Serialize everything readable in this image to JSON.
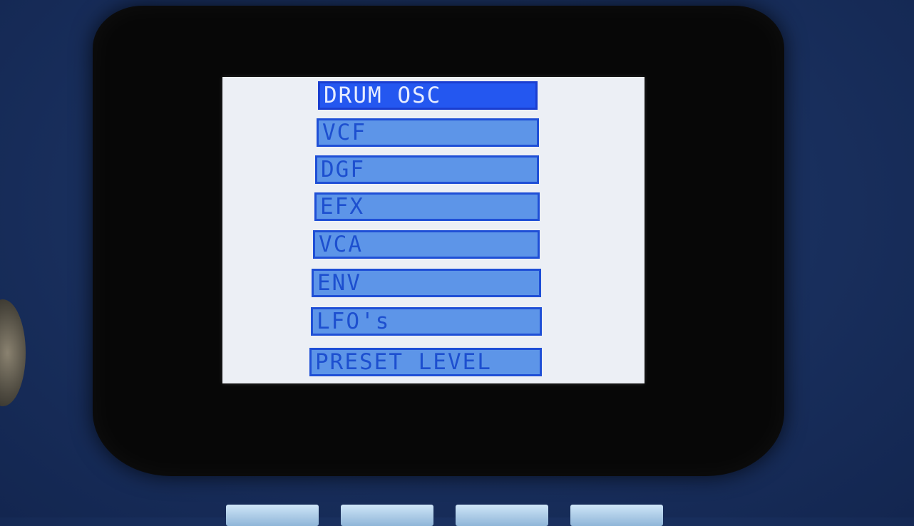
{
  "menu": {
    "items": [
      {
        "label": "DRUM OSC",
        "selected": true
      },
      {
        "label": "VCF",
        "selected": false
      },
      {
        "label": "DGF",
        "selected": false
      },
      {
        "label": "EFX",
        "selected": false
      },
      {
        "label": "VCA",
        "selected": false
      },
      {
        "label": "ENV",
        "selected": false
      },
      {
        "label": "LFO's",
        "selected": false
      },
      {
        "label": "PRESET LEVEL",
        "selected": false
      }
    ]
  },
  "colors": {
    "selected_bg": "#2457f0",
    "item_bg": "#5d95e8",
    "item_border": "#1f4fd6",
    "screen_bg": "#eceff5",
    "chassis": "#1a3160"
  }
}
